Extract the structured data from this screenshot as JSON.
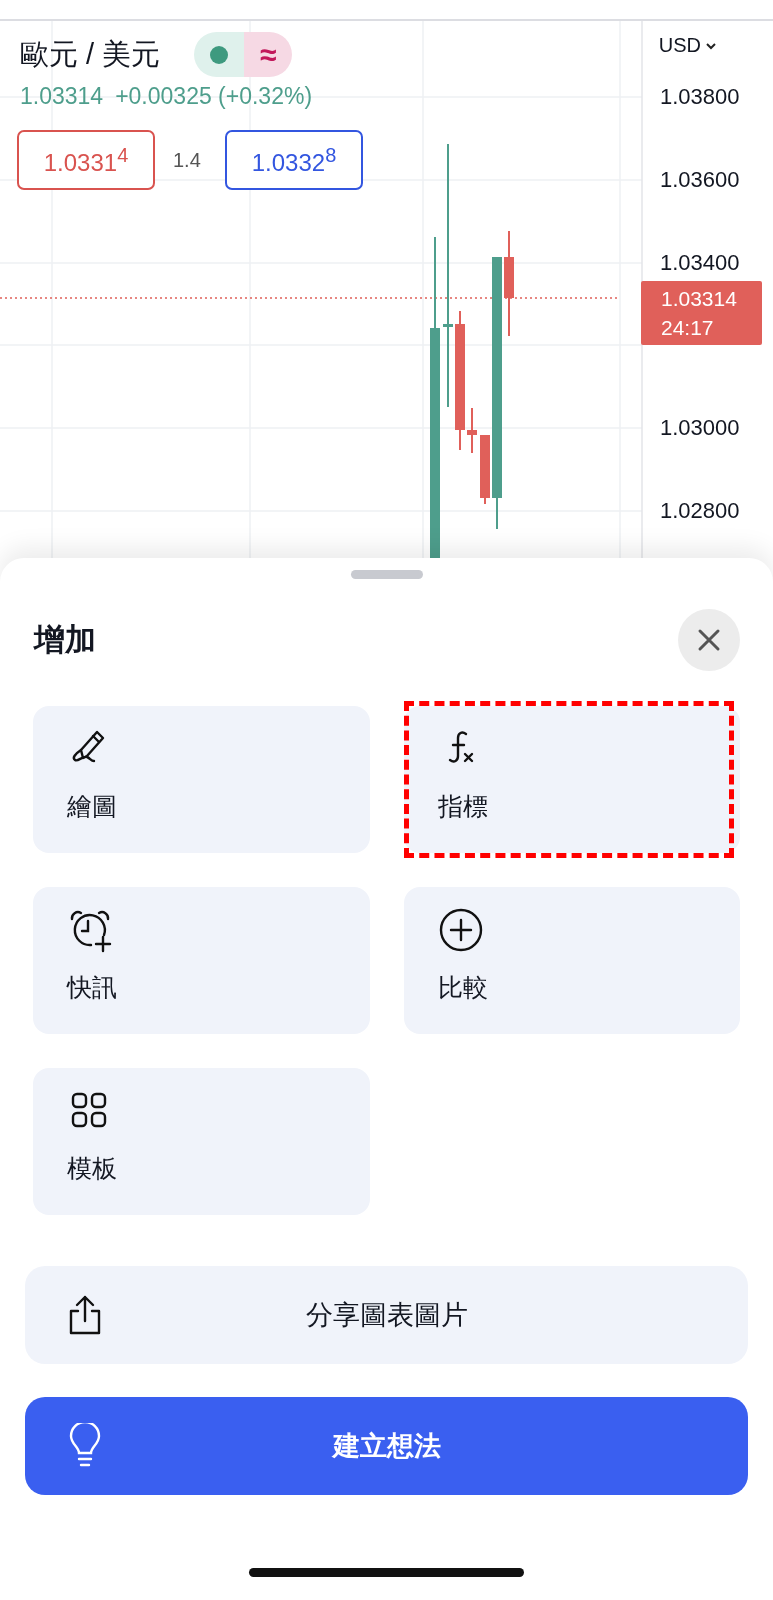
{
  "chart": {
    "symbol": "歐元 / 美元",
    "market_open": true,
    "delay_mark": "≈",
    "last": "1.03314",
    "change": "+0.00325 (+0.32%)",
    "bid": "1.0331$^{4}$",
    "spread": "1.4",
    "ask": "1.0332$^{8}$",
    "currency": "USD",
    "axis_labels": [
      "1.03800",
      "1.03600",
      "1.03400",
      "1.03000",
      "1.02800"
    ],
    "price_badge": {
      "price": "1.03314",
      "countdown": "24:17"
    }
  },
  "sheet": {
    "title": "增加",
    "items": [
      {
        "label": "繪圖",
        "highlighted": false
      },
      {
        "label": "指標",
        "highlighted": true
      },
      {
        "label": "快訊",
        "highlighted": false
      },
      {
        "label": "比較",
        "highlighted": false
      },
      {
        "label": "模板",
        "highlighted": false
      }
    ],
    "share_button": "分享圖表圖片",
    "primary_button": "建立想法"
  }
}
